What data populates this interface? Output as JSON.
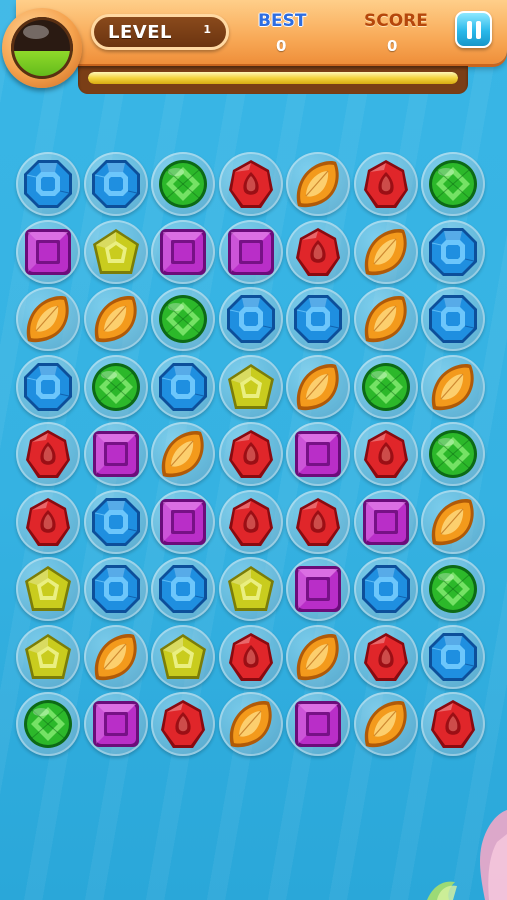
{
  "hud": {
    "level_label": "LEVEL",
    "level_value": "1",
    "best_label": "BEST",
    "best_value": "0",
    "score_label": "SCORE",
    "score_value": "0",
    "progress_fraction": 1.0,
    "pause_icon": "pause-icon",
    "orb_icon": "potion-orb-icon"
  },
  "colors": {
    "background": "#35b2e2",
    "header": "#f8a957",
    "progress": "#f4d43e"
  },
  "gem_types": {
    "blue": {
      "name": "blue-octagon-gem-icon",
      "light": "#7ad0ff",
      "mid": "#1f8fe0",
      "dark": "#0d4f9a"
    },
    "green": {
      "name": "green-round-gem-icon",
      "light": "#8ef07a",
      "mid": "#2cb82a",
      "dark": "#0d6a16"
    },
    "red": {
      "name": "red-drop-gem-icon",
      "light": "#ff8a80",
      "mid": "#e0262a",
      "dark": "#8a0a10"
    },
    "orange": {
      "name": "orange-leaf-gem-icon",
      "light": "#ffe08a",
      "mid": "#f39a1c",
      "dark": "#b05a08"
    },
    "purple": {
      "name": "purple-square-gem-icon",
      "light": "#f29bf5",
      "mid": "#b92ec8",
      "dark": "#6b0c7a"
    },
    "yellow": {
      "name": "yellow-pentagon-gem-icon",
      "light": "#f3f79a",
      "mid": "#c9cc1e",
      "dark": "#7b7d08"
    }
  },
  "board": [
    [
      "blue",
      "blue",
      "green",
      "red",
      "orange",
      "red",
      "green"
    ],
    [
      "purple",
      "yellow",
      "purple",
      "purple",
      "red",
      "orange",
      "blue"
    ],
    [
      "orange",
      "orange",
      "green",
      "blue",
      "blue",
      "orange",
      "blue"
    ],
    [
      "blue",
      "green",
      "blue",
      "yellow",
      "orange",
      "green",
      "orange"
    ],
    [
      "red",
      "purple",
      "orange",
      "red",
      "purple",
      "red",
      "green"
    ],
    [
      "red",
      "blue",
      "purple",
      "red",
      "red",
      "purple",
      "orange"
    ],
    [
      "yellow",
      "blue",
      "blue",
      "yellow",
      "purple",
      "blue",
      "green"
    ],
    [
      "yellow",
      "orange",
      "yellow",
      "red",
      "orange",
      "red",
      "blue"
    ],
    [
      "green",
      "purple",
      "red",
      "orange",
      "purple",
      "orange",
      "red"
    ]
  ]
}
